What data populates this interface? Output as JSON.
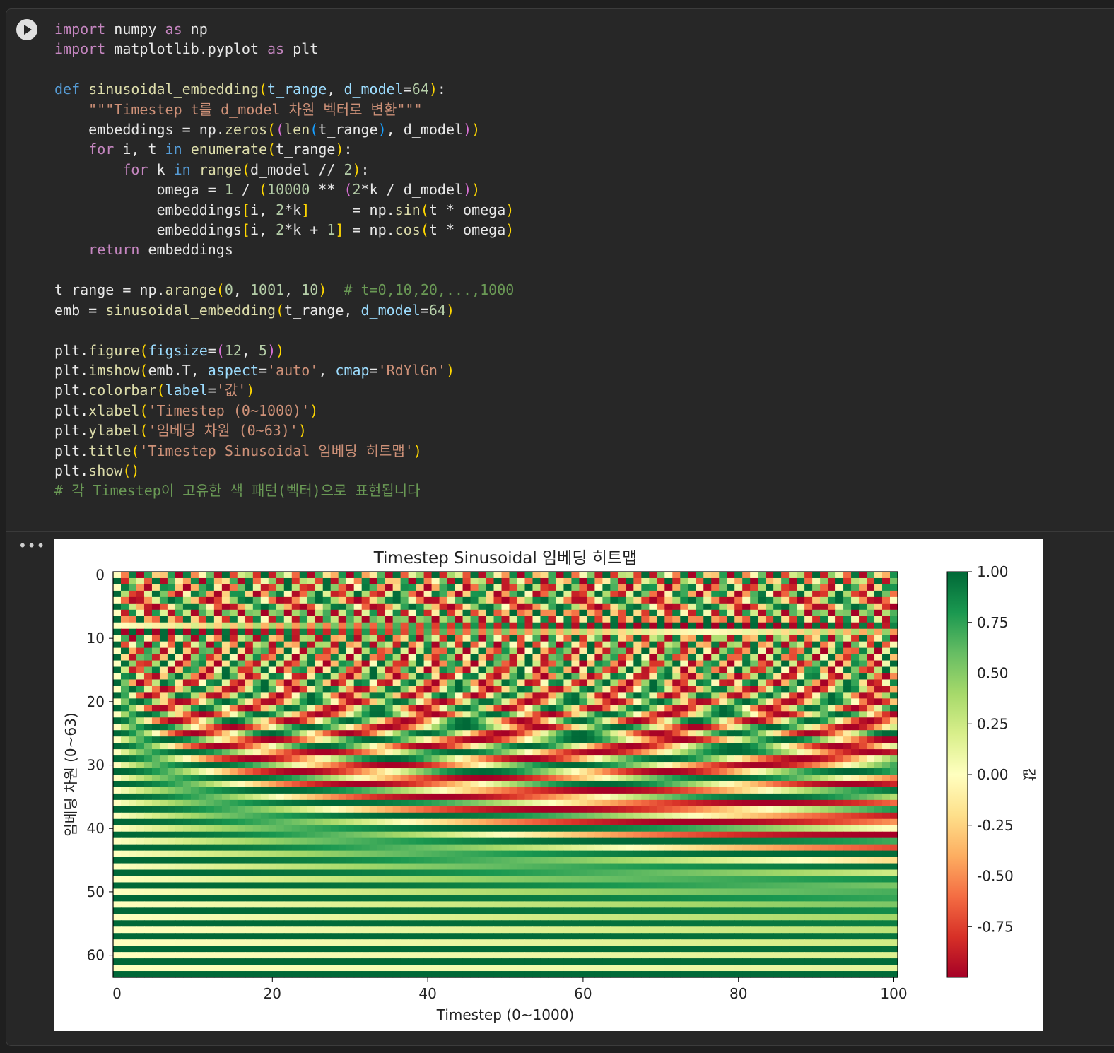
{
  "cell": {
    "run_button": "run-icon",
    "output_menu": "•••",
    "code_lines": [
      [
        [
          "kw",
          "import"
        ],
        [
          "",
          ""
        ],
        [
          "txt",
          " numpy "
        ],
        [
          "kw",
          "as"
        ],
        [
          "txt",
          " np"
        ]
      ],
      [
        [
          "kw",
          "import"
        ],
        [
          "txt",
          " matplotlib.pyplot "
        ],
        [
          "kw",
          "as"
        ],
        [
          "txt",
          " plt"
        ]
      ],
      [],
      [
        [
          "kw2",
          "def"
        ],
        [
          "txt",
          " "
        ],
        [
          "fn",
          "sinusoidal_embedding"
        ],
        [
          "p1",
          "("
        ],
        [
          "pr",
          "t_range"
        ],
        [
          "txt",
          ", "
        ],
        [
          "pr",
          "d_model"
        ],
        [
          "txt",
          "="
        ],
        [
          "num",
          "64"
        ],
        [
          "p1",
          ")"
        ],
        [
          "txt",
          ":"
        ]
      ],
      [
        [
          "txt",
          "    "
        ],
        [
          "str",
          "\"\"\"Timestep t를 d_model 차원 벡터로 변환\"\"\""
        ]
      ],
      [
        [
          "txt",
          "    embeddings = np."
        ],
        [
          "fn",
          "zeros"
        ],
        [
          "p1",
          "("
        ],
        [
          "p2",
          "("
        ],
        [
          "fn",
          "len"
        ],
        [
          "p3",
          "("
        ],
        [
          "txt",
          "t_range"
        ],
        [
          "p3",
          ")"
        ],
        [
          "txt",
          ", d_model"
        ],
        [
          "p2",
          ")"
        ],
        [
          "p1",
          ")"
        ]
      ],
      [
        [
          "txt",
          "    "
        ],
        [
          "kw",
          "for"
        ],
        [
          "txt",
          " i, t "
        ],
        [
          "kw2",
          "in"
        ],
        [
          "txt",
          " "
        ],
        [
          "fn",
          "enumerate"
        ],
        [
          "p1",
          "("
        ],
        [
          "txt",
          "t_range"
        ],
        [
          "p1",
          ")"
        ],
        [
          "txt",
          ":"
        ]
      ],
      [
        [
          "txt",
          "        "
        ],
        [
          "kw",
          "for"
        ],
        [
          "txt",
          " k "
        ],
        [
          "kw2",
          "in"
        ],
        [
          "txt",
          " "
        ],
        [
          "fn",
          "range"
        ],
        [
          "p1",
          "("
        ],
        [
          "txt",
          "d_model // "
        ],
        [
          "num",
          "2"
        ],
        [
          "p1",
          ")"
        ],
        [
          "txt",
          ":"
        ]
      ],
      [
        [
          "txt",
          "            omega = "
        ],
        [
          "num",
          "1"
        ],
        [
          "txt",
          " / "
        ],
        [
          "p1",
          "("
        ],
        [
          "num",
          "10000"
        ],
        [
          "txt",
          " ** "
        ],
        [
          "p2",
          "("
        ],
        [
          "num",
          "2"
        ],
        [
          "txt",
          "*k / d_model"
        ],
        [
          "p2",
          ")"
        ],
        [
          "p1",
          ")"
        ]
      ],
      [
        [
          "txt",
          "            embeddings"
        ],
        [
          "p1",
          "["
        ],
        [
          "txt",
          "i, "
        ],
        [
          "num",
          "2"
        ],
        [
          "txt",
          "*k"
        ],
        [
          "p1",
          "]"
        ],
        [
          "txt",
          "     = np."
        ],
        [
          "fn",
          "sin"
        ],
        [
          "p1",
          "("
        ],
        [
          "txt",
          "t * omega"
        ],
        [
          "p1",
          ")"
        ]
      ],
      [
        [
          "txt",
          "            embeddings"
        ],
        [
          "p1",
          "["
        ],
        [
          "txt",
          "i, "
        ],
        [
          "num",
          "2"
        ],
        [
          "txt",
          "*k + "
        ],
        [
          "num",
          "1"
        ],
        [
          "p1",
          "]"
        ],
        [
          "txt",
          " = np."
        ],
        [
          "fn",
          "cos"
        ],
        [
          "p1",
          "("
        ],
        [
          "txt",
          "t * omega"
        ],
        [
          "p1",
          ")"
        ]
      ],
      [
        [
          "txt",
          "    "
        ],
        [
          "kw",
          "return"
        ],
        [
          "txt",
          " embeddings"
        ]
      ],
      [],
      [
        [
          "txt",
          "t_range = np."
        ],
        [
          "fn",
          "arange"
        ],
        [
          "p1",
          "("
        ],
        [
          "num",
          "0"
        ],
        [
          "txt",
          ", "
        ],
        [
          "num",
          "1001"
        ],
        [
          "txt",
          ", "
        ],
        [
          "num",
          "10"
        ],
        [
          "p1",
          ")"
        ],
        [
          "txt",
          "  "
        ],
        [
          "cm",
          "# t=0,10,20,...,1000"
        ]
      ],
      [
        [
          "txt",
          "emb = "
        ],
        [
          "fn",
          "sinusoidal_embedding"
        ],
        [
          "p1",
          "("
        ],
        [
          "txt",
          "t_range, "
        ],
        [
          "pr",
          "d_model"
        ],
        [
          "txt",
          "="
        ],
        [
          "num",
          "64"
        ],
        [
          "p1",
          ")"
        ]
      ],
      [],
      [
        [
          "txt",
          "plt."
        ],
        [
          "fn",
          "figure"
        ],
        [
          "p1",
          "("
        ],
        [
          "pr",
          "figsize"
        ],
        [
          "txt",
          "="
        ],
        [
          "p2",
          "("
        ],
        [
          "num",
          "12"
        ],
        [
          "txt",
          ", "
        ],
        [
          "num",
          "5"
        ],
        [
          "p2",
          ")"
        ],
        [
          "p1",
          ")"
        ]
      ],
      [
        [
          "txt",
          "plt."
        ],
        [
          "fn",
          "imshow"
        ],
        [
          "p1",
          "("
        ],
        [
          "txt",
          "emb.T, "
        ],
        [
          "pr",
          "aspect"
        ],
        [
          "txt",
          "="
        ],
        [
          "str",
          "'auto'"
        ],
        [
          "txt",
          ", "
        ],
        [
          "pr",
          "cmap"
        ],
        [
          "txt",
          "="
        ],
        [
          "str",
          "'RdYlGn'"
        ],
        [
          "p1",
          ")"
        ]
      ],
      [
        [
          "txt",
          "plt."
        ],
        [
          "fn",
          "colorbar"
        ],
        [
          "p1",
          "("
        ],
        [
          "pr",
          "label"
        ],
        [
          "txt",
          "="
        ],
        [
          "str",
          "'값'"
        ],
        [
          "p1",
          ")"
        ]
      ],
      [
        [
          "txt",
          "plt."
        ],
        [
          "fn",
          "xlabel"
        ],
        [
          "p1",
          "("
        ],
        [
          "str",
          "'Timestep (0~1000)'"
        ],
        [
          "p1",
          ")"
        ]
      ],
      [
        [
          "txt",
          "plt."
        ],
        [
          "fn",
          "ylabel"
        ],
        [
          "p1",
          "("
        ],
        [
          "str",
          "'임베딩 차원 (0~63)'"
        ],
        [
          "p1",
          ")"
        ]
      ],
      [
        [
          "txt",
          "plt."
        ],
        [
          "fn",
          "title"
        ],
        [
          "p1",
          "("
        ],
        [
          "str",
          "'Timestep Sinusoidal 임베딩 히트맵'"
        ],
        [
          "p1",
          ")"
        ]
      ],
      [
        [
          "txt",
          "plt."
        ],
        [
          "fn",
          "show"
        ],
        [
          "p1",
          "()"
        ]
      ],
      [
        [
          "cm",
          "# 각 Timestep이 고유한 색 패턴(벡터)으로 표현됩니다"
        ]
      ]
    ]
  },
  "colors": {
    "keyword": "#c586c0",
    "def": "#569cd6",
    "function": "#dcdcaa",
    "param": "#9cdcfe",
    "number": "#b5cea8",
    "string": "#ce9178",
    "comment": "#6a9955"
  },
  "chart_data": {
    "type": "heatmap",
    "title": "Timestep Sinusoidal 임베딩 히트맵",
    "xlabel": "Timestep (0~1000)",
    "ylabel": "임베딩 차원 (0~63)",
    "colorbar_label": "값",
    "colormap": "RdYlGn",
    "x_ticks": [
      "0",
      "20",
      "40",
      "60",
      "80",
      "100"
    ],
    "y_ticks": [
      "0",
      "10",
      "20",
      "30",
      "40",
      "50",
      "60"
    ],
    "colorbar_ticks": [
      "1.00",
      "0.75",
      "0.50",
      "0.25",
      "0.00",
      "-0.25",
      "-0.50",
      "-0.75"
    ],
    "n_columns": 101,
    "n_rows": 64,
    "x_values": "t = 0, 10, 20, ..., 1000 (column index 0..100)",
    "value_formula": "row 2k = sin(t / 10000^(2k/64)), row 2k+1 = cos(t / 10000^(2k/64))",
    "zlim": [
      -1,
      1
    ]
  }
}
